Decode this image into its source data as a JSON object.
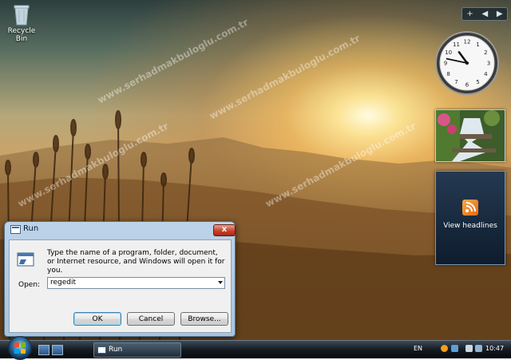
{
  "desktop": {
    "recycle_bin_label": "Recycle Bin",
    "watermark_text": "www.serhadmakbuloglu.com.tr"
  },
  "gadgets": {
    "sidebar_controls": [
      "+",
      "◀",
      "▶"
    ],
    "clock_time": "10:47",
    "feed_label": "View headlines"
  },
  "run_dialog": {
    "title": "Run",
    "close_glyph": "x",
    "description": "Type the name of a program, folder, document, or Internet resource, and Windows will open it for you.",
    "open_label": "Open:",
    "open_value": "regedit",
    "ok_label": "OK",
    "cancel_label": "Cancel",
    "browse_label": "Browse..."
  },
  "taskbar": {
    "active_task": "Run",
    "language": "EN",
    "time": "10:47"
  },
  "colors": {
    "close_red": "#c8422b",
    "feed_orange": "#e66a12",
    "taskbar": "#141b22"
  }
}
